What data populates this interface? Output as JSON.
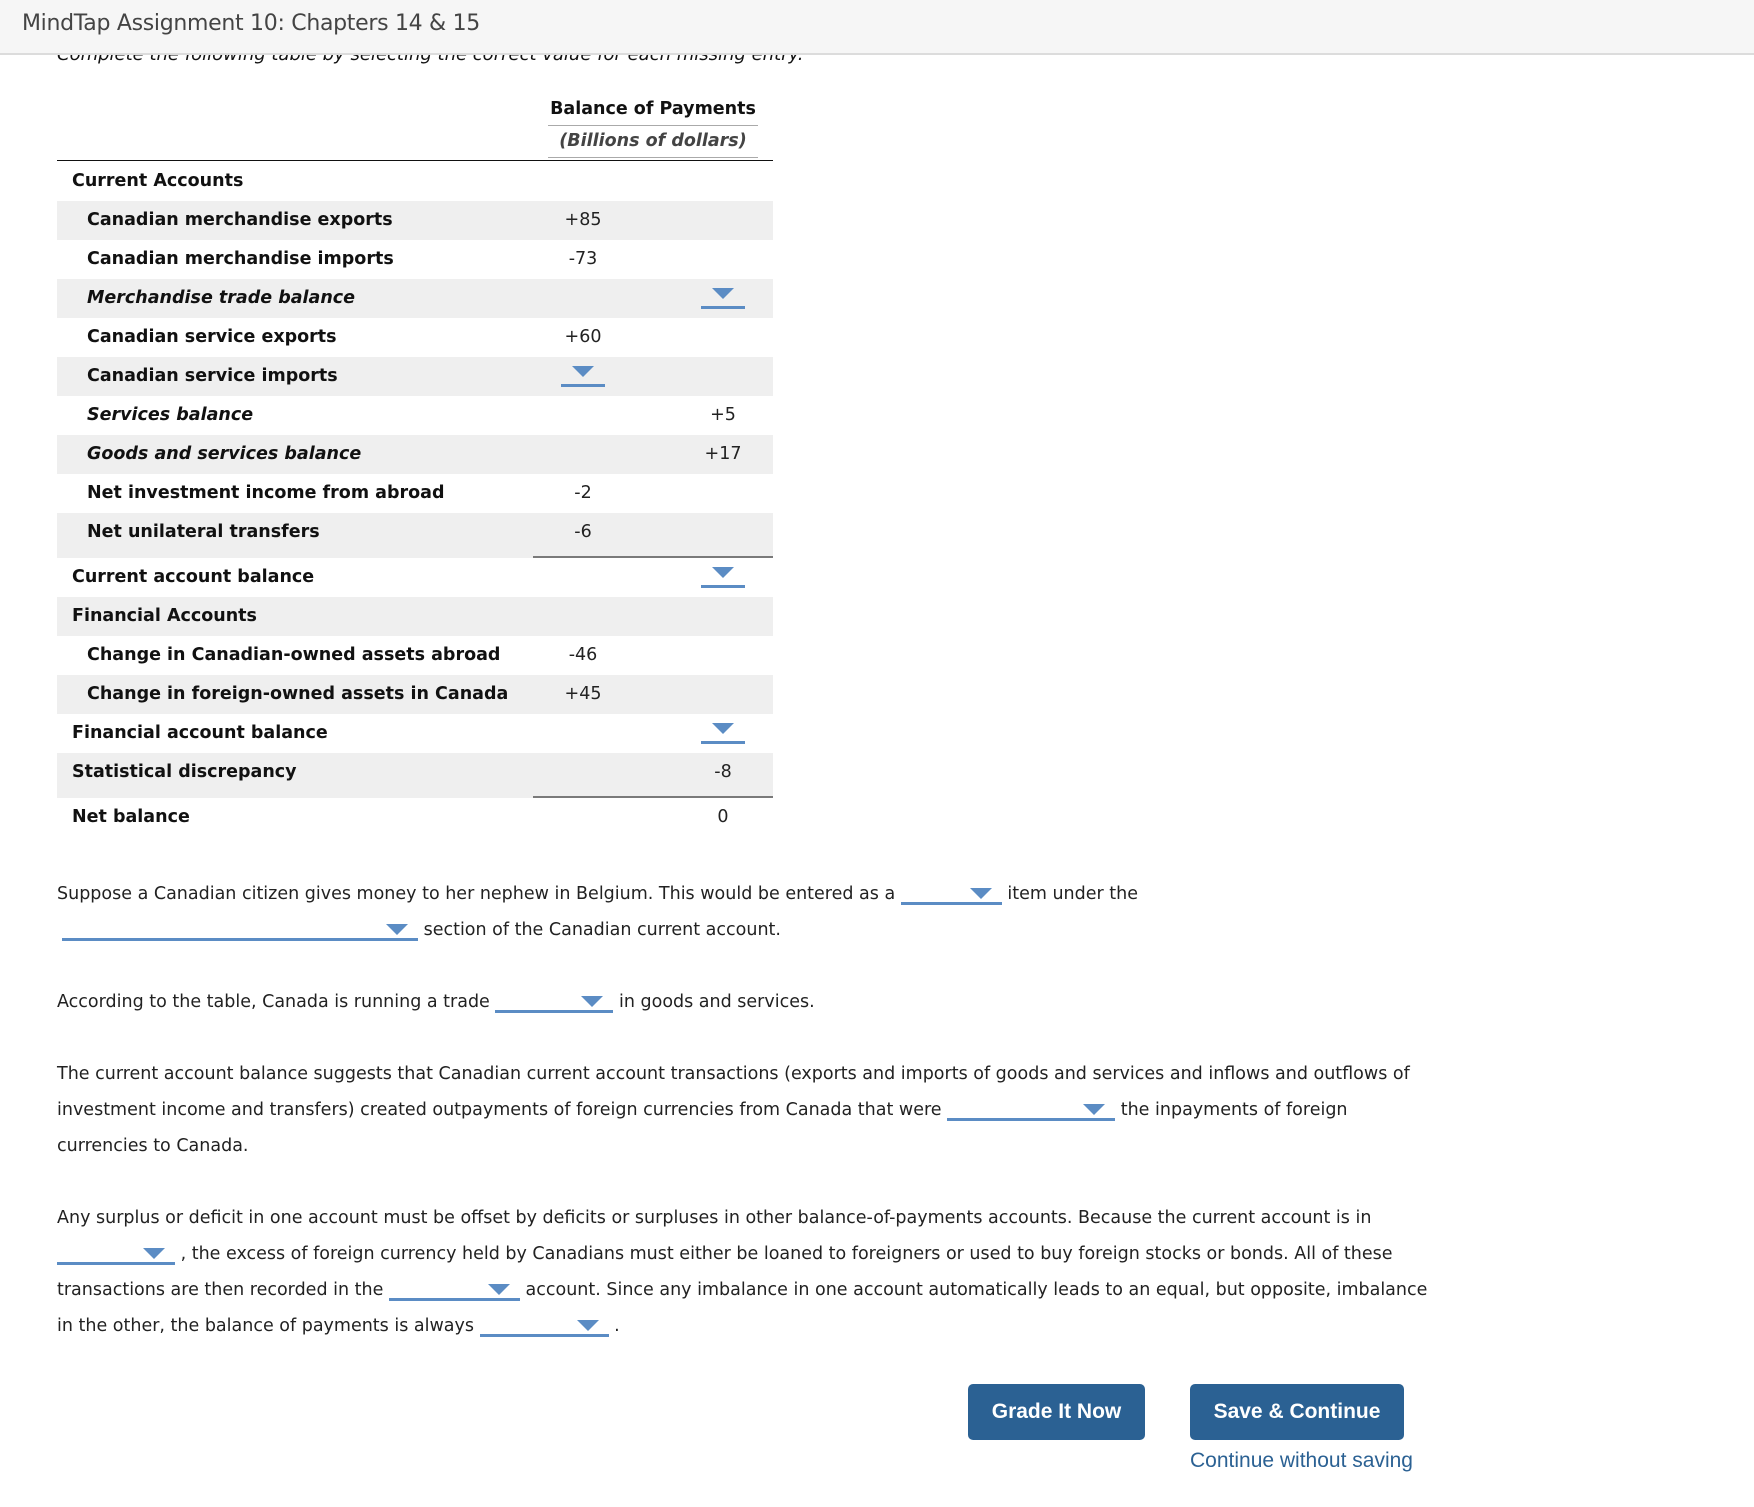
{
  "header": {
    "title": "MindTap Assignment 10: Chapters 14 & 15"
  },
  "instruction": "Complete the following table by selecting the correct value for each missing entry.",
  "table": {
    "heading": "Balance of Payments",
    "subheading": "(Billions of dollars)",
    "rows": [
      {
        "label": "Current Accounts",
        "c1": "",
        "c2": ""
      },
      {
        "label": "Canadian merchandise exports",
        "c1": "+85",
        "c2": ""
      },
      {
        "label": "Canadian merchandise imports",
        "c1": "-73",
        "c2": ""
      },
      {
        "label": "Merchandise trade balance",
        "c1": "",
        "c2": "",
        "c2_dropdown": ""
      },
      {
        "label": "Canadian service exports",
        "c1": "+60",
        "c2": ""
      },
      {
        "label": "Canadian service imports",
        "c1": "",
        "c1_dropdown": "",
        "c2": ""
      },
      {
        "label": "Services balance",
        "c1": "",
        "c2": "+5"
      },
      {
        "label": "Goods and services balance",
        "c1": "",
        "c2": "+17"
      },
      {
        "label": "Net investment income from abroad",
        "c1": "-2",
        "c2": ""
      },
      {
        "label": "Net unilateral transfers",
        "c1": "-6",
        "c2": ""
      },
      {
        "label": "Current account balance",
        "c1": "",
        "c2": "",
        "c2_dropdown": ""
      },
      {
        "label": "Financial Accounts",
        "c1": "",
        "c2": ""
      },
      {
        "label": "Change in Canadian-owned assets abroad",
        "c1": "-46",
        "c2": ""
      },
      {
        "label": "Change in foreign-owned assets in Canada",
        "c1": "+45",
        "c2": ""
      },
      {
        "label": "Financial account balance",
        "c1": "",
        "c2": "",
        "c2_dropdown": ""
      },
      {
        "label": "Statistical discrepancy",
        "c1": "",
        "c2": "-8"
      },
      {
        "label": "Net balance",
        "c1": "",
        "c2": "0"
      }
    ]
  },
  "questions": {
    "q1": {
      "part1": "Suppose a Canadian citizen gives money to her nephew in Belgium. This would be entered as a",
      "dropdown1_value": "",
      "part2": "item under the",
      "dropdown2_value": "",
      "part3": "section of the Canadian current account."
    },
    "q2": {
      "part1": "According to the table, Canada is running a trade",
      "dropdown_value": "",
      "part2": "in goods and services."
    },
    "q3": {
      "part1": "The current account balance suggests that Canadian current account transactions (exports and imports of goods and services and inflows and outflows of investment income and transfers) created outpayments of foreign currencies from Canada that were",
      "dropdown_value": "",
      "part2": "the inpayments of foreign currencies to Canada."
    },
    "q4": {
      "part1": "Any surplus or deficit in one account must be offset by deficits or surpluses in other balance-of-payments accounts. Because the current account is in",
      "dropdown1_value": "",
      "part2": ", the excess of foreign currency held by Canadians must either be loaned to foreigners or used to buy foreign stocks or bonds. All of these transactions are then recorded in the",
      "dropdown2_value": "",
      "part3": "account. Since any imbalance in one account automatically leads to an equal, but opposite, imbalance in the other, the balance of payments is always",
      "dropdown3_value": "",
      "part4": "."
    }
  },
  "buttons": {
    "grade": "Grade It Now",
    "save": "Save & Continue",
    "continue_without_saving": "Continue without saving"
  },
  "colors": {
    "accent": "#2b6193",
    "dropdown": "#5b8cc4",
    "row_shade": "#efefef"
  }
}
